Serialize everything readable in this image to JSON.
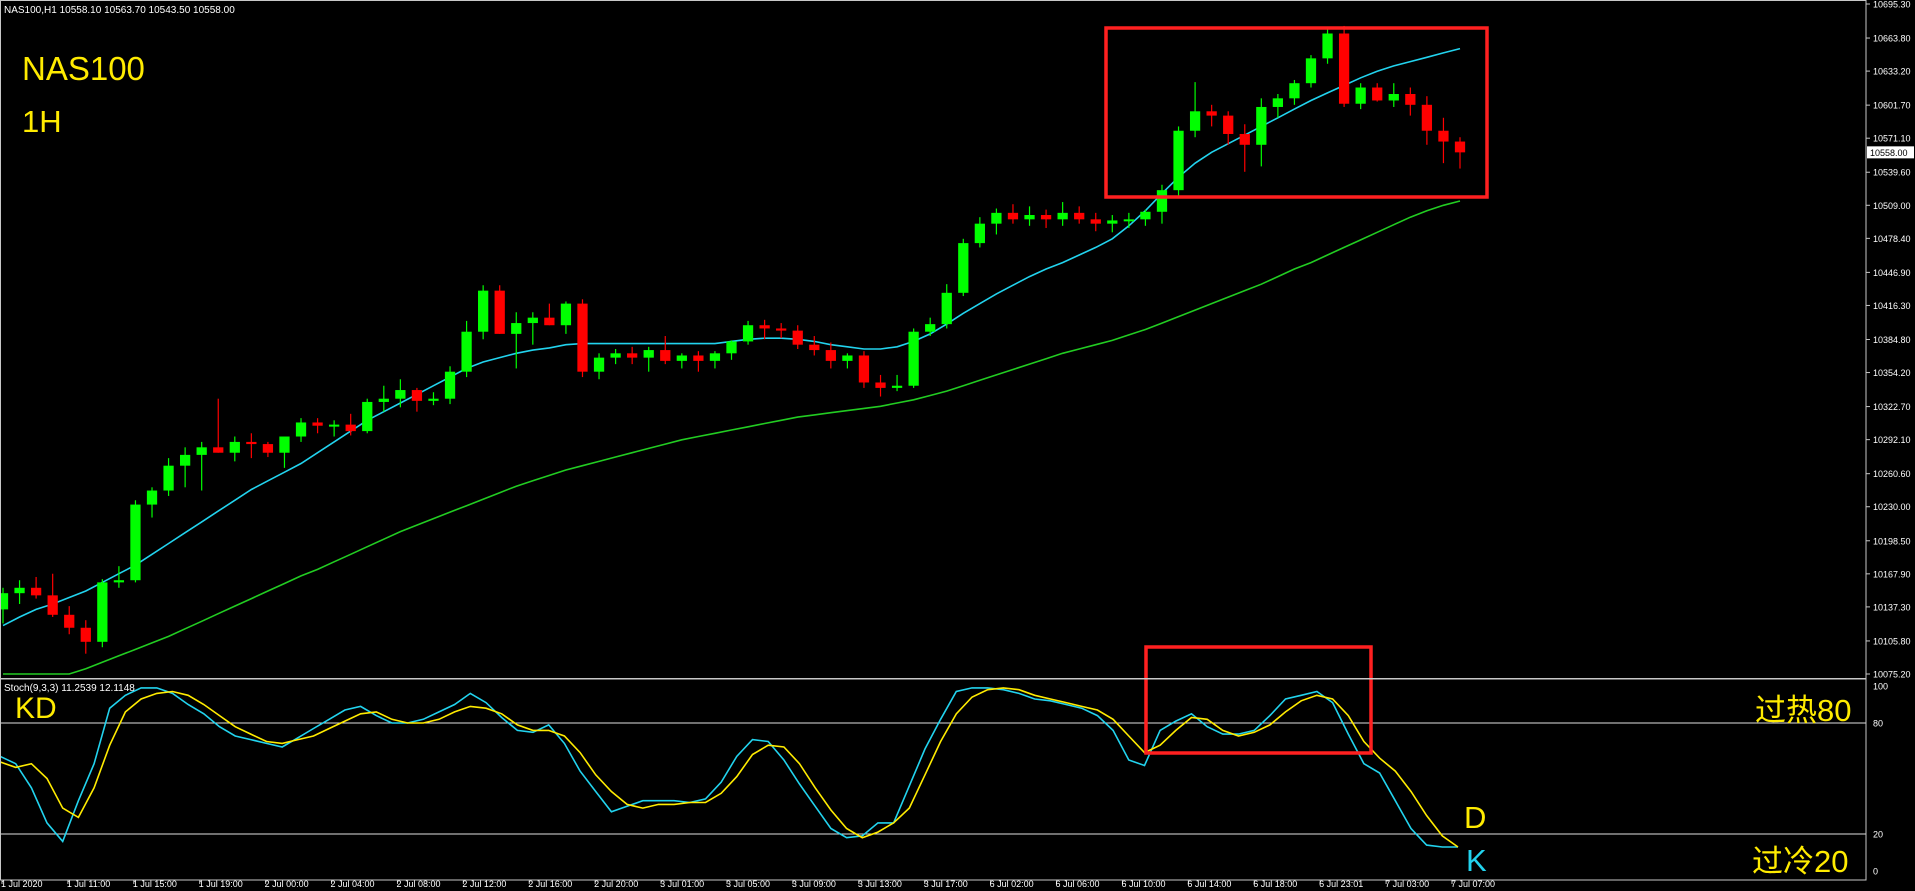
{
  "header": {
    "main_info": "NAS100,H1  10558.10 10563.70 10543.50 10558.00",
    "stoch_info": "Stoch(9,3,3) 11.2539 12.1148"
  },
  "annotations": {
    "symbol": "NAS100",
    "timeframe": "1H",
    "kd_label": "KD",
    "overbought_label": "过热80",
    "oversold_label": "过冷20",
    "d_label": "D",
    "k_label": "K"
  },
  "colors": {
    "background": "#000000",
    "bull_candle": "#00ff00",
    "bear_candle": "#ff0000",
    "ma_fast": "#22d3ee",
    "ma_slow": "#22cc22",
    "stoch_k": "#22d3ee",
    "stoch_d": "#ffeb00",
    "grid_text": "#ffffff",
    "highlight_box": "#ff2020",
    "annotation": "#ffeb00"
  },
  "chart_data": [
    {
      "type": "candlestick",
      "symbol": "NAS100",
      "timeframe": "H1",
      "current_price": "10558.00",
      "ylim": [
        10075.2,
        10695.3
      ],
      "price_axis_ticks": [
        "10695.30",
        "10663.80",
        "10633.20",
        "10601.70",
        "10571.10",
        "10539.60",
        "10509.00",
        "10478.40",
        "10446.90",
        "10416.30",
        "10384.80",
        "10354.20",
        "10322.70",
        "10292.10",
        "10260.60",
        "10230.00",
        "10198.50",
        "10167.90",
        "10137.30",
        "10105.80",
        "10075.20"
      ],
      "time_axis_ticks": [
        "1 Jul 2020",
        "1 Jul 11:00",
        "1 Jul 15:00",
        "1 Jul 19:00",
        "2 Jul 00:00",
        "2 Jul 04:00",
        "2 Jul 08:00",
        "2 Jul 12:00",
        "2 Jul 16:00",
        "2 Jul 20:00",
        "3 Jul 01:00",
        "3 Jul 05:00",
        "3 Jul 09:00",
        "3 Jul 13:00",
        "3 Jul 17:00",
        "6 Jul 02:00",
        "6 Jul 06:00",
        "6 Jul 10:00",
        "6 Jul 14:00",
        "6 Jul 18:00",
        "6 Jul 23:01",
        "7 Jul 03:00",
        "7 Jul 07:00"
      ],
      "candles": [
        [
          10135,
          10155,
          10122,
          10150
        ],
        [
          10150,
          10162,
          10140,
          10155
        ],
        [
          10155,
          10165,
          10145,
          10148
        ],
        [
          10148,
          10168,
          10128,
          10130
        ],
        [
          10130,
          10138,
          10112,
          10118
        ],
        [
          10118,
          10125,
          10094,
          10105
        ],
        [
          10105,
          10163,
          10100,
          10160
        ],
        [
          10160,
          10175,
          10155,
          10162
        ],
        [
          10162,
          10236,
          10160,
          10232
        ],
        [
          10232,
          10248,
          10220,
          10245
        ],
        [
          10245,
          10275,
          10240,
          10268
        ],
        [
          10268,
          10285,
          10248,
          10278
        ],
        [
          10278,
          10290,
          10245,
          10285
        ],
        [
          10285,
          10330,
          10280,
          10280
        ],
        [
          10280,
          10295,
          10272,
          10290
        ],
        [
          10290,
          10298,
          10275,
          10288
        ],
        [
          10288,
          10290,
          10276,
          10280
        ],
        [
          10280,
          10292,
          10266,
          10295
        ],
        [
          10295,
          10312,
          10290,
          10308
        ],
        [
          10308,
          10312,
          10298,
          10305
        ],
        [
          10305,
          10310,
          10295,
          10306
        ],
        [
          10306,
          10316,
          10296,
          10300
        ],
        [
          10300,
          10330,
          10298,
          10327
        ],
        [
          10327,
          10342,
          10318,
          10330
        ],
        [
          10330,
          10348,
          10322,
          10338
        ],
        [
          10338,
          10340,
          10318,
          10328
        ],
        [
          10328,
          10336,
          10324,
          10330
        ],
        [
          10330,
          10360,
          10325,
          10355
        ],
        [
          10355,
          10402,
          10350,
          10392
        ],
        [
          10392,
          10435,
          10385,
          10430
        ],
        [
          10430,
          10435,
          10390,
          10390
        ],
        [
          10390,
          10410,
          10358,
          10400
        ],
        [
          10400,
          10410,
          10380,
          10405
        ],
        [
          10405,
          10418,
          10398,
          10398
        ],
        [
          10398,
          10420,
          10390,
          10418
        ],
        [
          10418,
          10422,
          10350,
          10355
        ],
        [
          10355,
          10372,
          10348,
          10368
        ],
        [
          10368,
          10376,
          10362,
          10372
        ],
        [
          10372,
          10378,
          10362,
          10368
        ],
        [
          10368,
          10378,
          10355,
          10375
        ],
        [
          10375,
          10388,
          10362,
          10365
        ],
        [
          10365,
          10372,
          10358,
          10370
        ],
        [
          10370,
          10374,
          10355,
          10365
        ],
        [
          10365,
          10374,
          10358,
          10372
        ],
        [
          10372,
          10384,
          10366,
          10383
        ],
        [
          10383,
          10402,
          10380,
          10398
        ],
        [
          10398,
          10403,
          10385,
          10395
        ],
        [
          10395,
          10400,
          10386,
          10393
        ],
        [
          10393,
          10398,
          10376,
          10380
        ],
        [
          10380,
          10388,
          10370,
          10375
        ],
        [
          10375,
          10382,
          10358,
          10365
        ],
        [
          10365,
          10372,
          10358,
          10370
        ],
        [
          10370,
          10374,
          10340,
          10345
        ],
        [
          10345,
          10352,
          10332,
          10340
        ],
        [
          10340,
          10352,
          10337,
          10342
        ],
        [
          10342,
          10395,
          10340,
          10392
        ],
        [
          10392,
          10405,
          10388,
          10399
        ],
        [
          10399,
          10436,
          10395,
          10428
        ],
        [
          10428,
          10478,
          10425,
          10474
        ],
        [
          10474,
          10498,
          10470,
          10492
        ],
        [
          10492,
          10506,
          10482,
          10502
        ],
        [
          10502,
          10510,
          10492,
          10496
        ],
        [
          10496,
          10508,
          10490,
          10500
        ],
        [
          10500,
          10505,
          10488,
          10496
        ],
        [
          10496,
          10512,
          10490,
          10502
        ],
        [
          10502,
          10508,
          10492,
          10496
        ],
        [
          10496,
          10502,
          10485,
          10492
        ],
        [
          10492,
          10500,
          10484,
          10495
        ],
        [
          10495,
          10502,
          10488,
          10496
        ],
        [
          10496,
          10505,
          10490,
          10503
        ],
        [
          10503,
          10528,
          10492,
          10523
        ],
        [
          10523,
          10582,
          10518,
          10578
        ],
        [
          10578,
          10623,
          10572,
          10596
        ],
        [
          10596,
          10602,
          10582,
          10592
        ],
        [
          10592,
          10596,
          10565,
          10575
        ],
        [
          10575,
          10584,
          10540,
          10565
        ],
        [
          10565,
          10608,
          10545,
          10600
        ],
        [
          10600,
          10612,
          10590,
          10608
        ],
        [
          10608,
          10625,
          10602,
          10622
        ],
        [
          10622,
          10648,
          10618,
          10645
        ],
        [
          10645,
          10672,
          10640,
          10668
        ],
        [
          10668,
          10675,
          10600,
          10603
        ],
        [
          10603,
          10622,
          10598,
          10618
        ],
        [
          10618,
          10622,
          10605,
          10606
        ],
        [
          10606,
          10622,
          10600,
          10612
        ],
        [
          10612,
          10618,
          10592,
          10602
        ],
        [
          10602,
          10610,
          10565,
          10578
        ],
        [
          10578,
          10590,
          10548,
          10568
        ],
        [
          10568,
          10572,
          10543,
          10558
        ]
      ],
      "ma_fast": [
        10120,
        10128,
        10135,
        10140,
        10146,
        10152,
        10160,
        10168,
        10176,
        10186,
        10196,
        10206,
        10216,
        10226,
        10236,
        10246,
        10254,
        10262,
        10270,
        10280,
        10290,
        10300,
        10310,
        10318,
        10326,
        10334,
        10342,
        10350,
        10358,
        10364,
        10368,
        10372,
        10375,
        10377,
        10380,
        10381,
        10381,
        10381,
        10381,
        10381,
        10381,
        10381,
        10381,
        10381,
        10383,
        10385,
        10386,
        10386,
        10385,
        10383,
        10380,
        10378,
        10376,
        10376,
        10378,
        10383,
        10390,
        10399,
        10409,
        10418,
        10427,
        10435,
        10443,
        10450,
        10456,
        10463,
        10470,
        10478,
        10490,
        10504,
        10520,
        10535,
        10548,
        10558,
        10566,
        10574,
        10582,
        10590,
        10598,
        10606,
        10613,
        10620,
        10627,
        10633,
        10638,
        10642,
        10646,
        10650,
        10654
      ],
      "ma_slow": [
        10050,
        10056,
        10062,
        10068,
        10074,
        10080,
        10086,
        10092,
        10098,
        10104,
        10110,
        10117,
        10124,
        10131,
        10138,
        10145,
        10152,
        10159,
        10166,
        10172,
        10179,
        10186,
        10193,
        10200,
        10207,
        10213,
        10219,
        10225,
        10231,
        10237,
        10243,
        10249,
        10254,
        10259,
        10264,
        10268,
        10272,
        10276,
        10280,
        10284,
        10288,
        10292,
        10295,
        10298,
        10301,
        10304,
        10307,
        10310,
        10313,
        10315,
        10317,
        10319,
        10321,
        10323,
        10326,
        10329,
        10333,
        10337,
        10342,
        10347,
        10352,
        10357,
        10362,
        10367,
        10372,
        10376,
        10380,
        10384,
        10389,
        10394,
        10400,
        10406,
        10412,
        10418,
        10424,
        10430,
        10436,
        10443,
        10450,
        10456,
        10463,
        10470,
        10477,
        10484,
        10491,
        10498,
        10504,
        10509,
        10513
      ]
    },
    {
      "type": "line",
      "name": "Stoch(9,3,3)",
      "ylim": [
        0,
        100
      ],
      "levels": [
        20,
        80
      ],
      "axis_ticks": [
        "100",
        "80",
        "20",
        "0"
      ],
      "current_values": {
        "main": 11.2539,
        "signal": 12.1148
      },
      "series": [
        {
          "name": "K",
          "values": [
            62,
            58,
            45,
            26,
            16,
            38,
            58,
            88,
            95,
            99,
            99,
            96,
            90,
            85,
            78,
            73,
            71,
            69,
            67,
            72,
            77,
            82,
            87,
            89,
            84,
            80,
            80,
            82,
            86,
            90,
            96,
            91,
            83,
            76,
            75,
            79,
            69,
            54,
            43,
            32,
            35,
            38,
            38,
            38,
            37,
            39,
            48,
            62,
            71,
            70,
            60,
            47,
            35,
            23,
            18,
            19,
            26,
            26,
            46,
            66,
            82,
            97,
            99,
            99,
            98,
            96,
            93,
            92,
            90,
            88,
            84,
            76,
            60,
            57,
            76,
            81,
            85,
            78,
            74,
            74,
            76,
            84,
            93,
            95,
            97,
            91,
            74,
            58,
            53,
            38,
            23,
            14,
            13,
            13
          ]
        },
        {
          "name": "D",
          "values": [
            59,
            56,
            58,
            50,
            34,
            29,
            45,
            68,
            86,
            93,
            96,
            97,
            95,
            90,
            84,
            78,
            74,
            70,
            69,
            71,
            73,
            77,
            81,
            85,
            86,
            82,
            80,
            80,
            82,
            86,
            89,
            88,
            85,
            79,
            76,
            76,
            73,
            64,
            52,
            43,
            36,
            34,
            36,
            36,
            37,
            37,
            42,
            51,
            63,
            68,
            67,
            58,
            45,
            33,
            23,
            18,
            21,
            26,
            34,
            52,
            70,
            85,
            94,
            98,
            99,
            98,
            95,
            93,
            91,
            89,
            87,
            82,
            73,
            64,
            68,
            76,
            83,
            82,
            76,
            73,
            75,
            79,
            86,
            92,
            95,
            93,
            84,
            70,
            61,
            54,
            43,
            30,
            19,
            13
          ]
        }
      ]
    }
  ]
}
